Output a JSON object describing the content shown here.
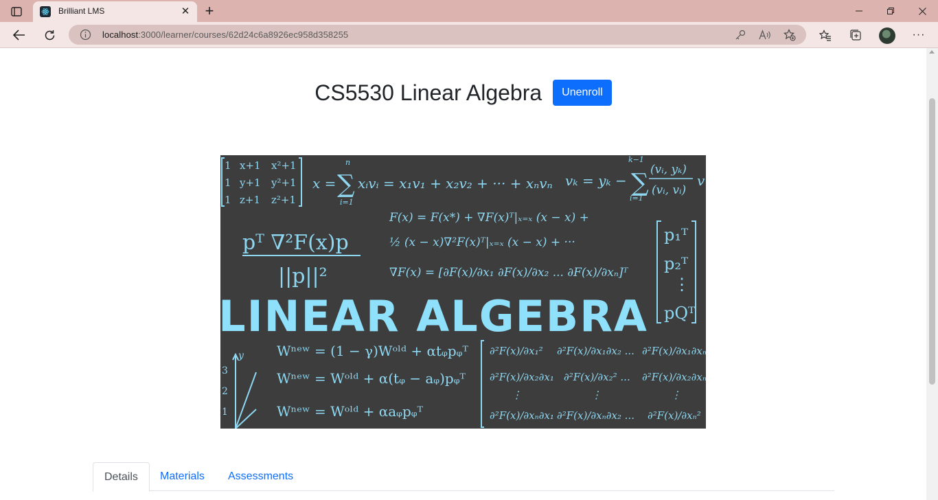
{
  "browser": {
    "tab_title": "Brilliant LMS",
    "tab_close": "✕",
    "new_tab": "+",
    "url_host": "localhost",
    "url_path": ":3000/learner/courses/62d24c6a8926ec958d358255",
    "window_controls": {
      "minimize": "—",
      "restore": "❐",
      "close": "✕"
    },
    "more": "···"
  },
  "course": {
    "title": "CS5530 Linear Algebra",
    "unenroll_label": "Unenroll",
    "image": {
      "heading": "LINEAR ALGEBRA"
    }
  },
  "tabs": [
    {
      "label": "Details",
      "active": true
    },
    {
      "label": "Materials",
      "active": false
    },
    {
      "label": "Assessments",
      "active": false
    }
  ],
  "colors": {
    "primary": "#0d6efd",
    "banner_bg": "#3d3d3d",
    "chalk": "#8fd8f2",
    "chrome": "#dcb3ae"
  }
}
